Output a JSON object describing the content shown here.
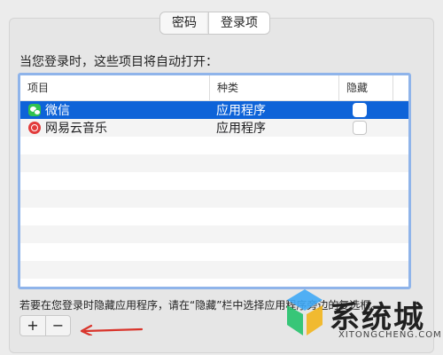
{
  "tabs": [
    {
      "label": "密码",
      "active": false
    },
    {
      "label": "登录项",
      "active": true
    }
  ],
  "heading": "当您登录时，这些项目将自动打开：",
  "table": {
    "columns": [
      "项目",
      "种类",
      "隐藏"
    ],
    "rows": [
      {
        "name": "微信",
        "kind": "应用程序",
        "icon": "wechat-icon",
        "hidden": false,
        "selected": true
      },
      {
        "name": "网易云音乐",
        "kind": "应用程序",
        "icon": "netease-music-icon",
        "hidden": false,
        "selected": false
      }
    ]
  },
  "note": "若要在您登录时隐藏应用程序，请在“隐藏”栏中选择应用程序旁边的复选框。",
  "buttons": {
    "add": "+",
    "remove": "−"
  },
  "watermark": {
    "text": "系统城",
    "url": "XITONGCHENG.COM"
  },
  "colors": {
    "selection": "#0e63d8",
    "focus_ring": "#8fb4ea",
    "arrow": "#d9342b"
  }
}
